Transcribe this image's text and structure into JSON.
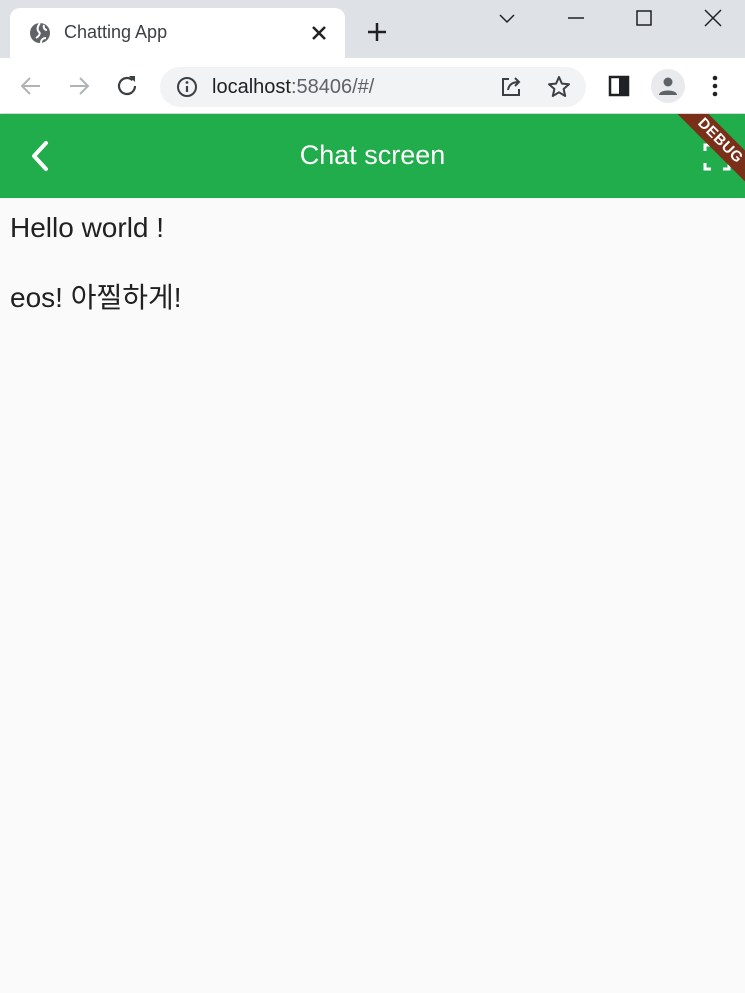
{
  "browser": {
    "tab_title": "Chatting App",
    "url_host": "localhost",
    "url_path": ":58406/#/"
  },
  "app": {
    "title": "Chat screen",
    "debug_banner": "DEBUG",
    "accent_color": "#21ad4b"
  },
  "messages": [
    "Hello world !",
    "eos! 아찔하게!"
  ]
}
